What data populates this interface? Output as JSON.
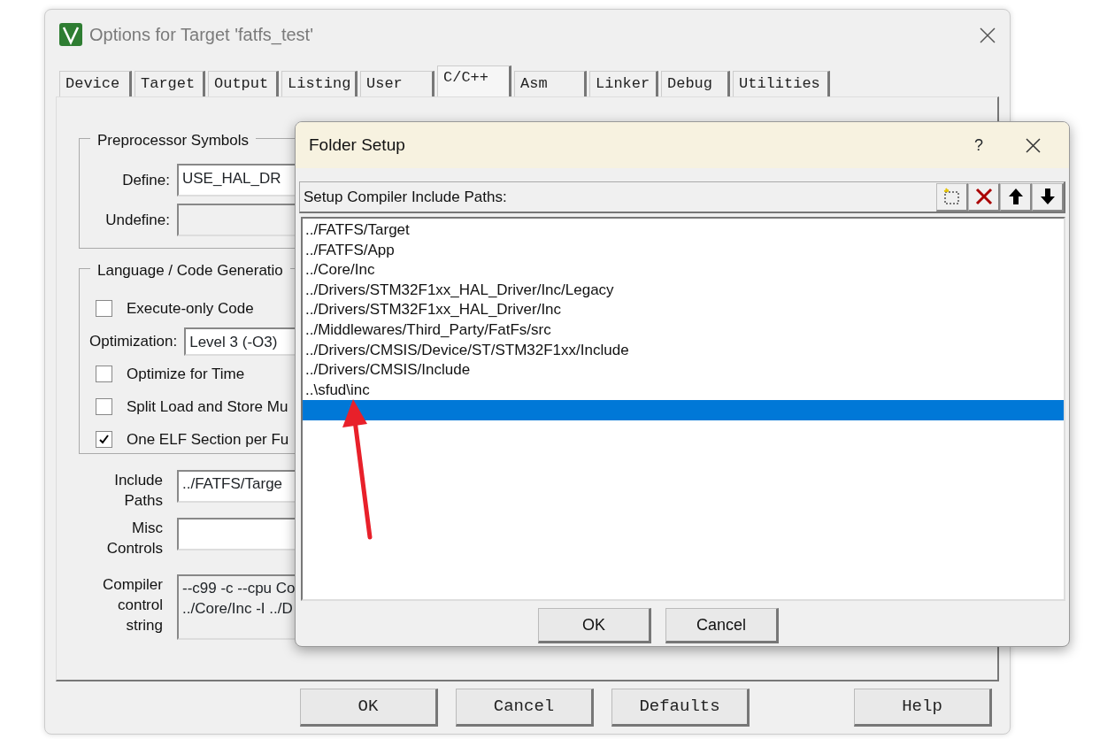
{
  "window": {
    "title": "Options for Target 'fatfs_test'"
  },
  "tabs": [
    {
      "label": "Device",
      "selected": false
    },
    {
      "label": "Target",
      "selected": false
    },
    {
      "label": "Output",
      "selected": false
    },
    {
      "label": "Listing",
      "selected": false
    },
    {
      "label": "User",
      "selected": false
    },
    {
      "label": "C/C++",
      "selected": true
    },
    {
      "label": "Asm",
      "selected": false
    },
    {
      "label": "Linker",
      "selected": false
    },
    {
      "label": "Debug",
      "selected": false
    },
    {
      "label": "Utilities",
      "selected": false
    }
  ],
  "preprocessor": {
    "title": "Preprocessor Symbols",
    "fields": [
      {
        "label": "Define:",
        "value": "USE_HAL_DR"
      },
      {
        "label": "Undefine:"
      }
    ]
  },
  "language": {
    "title": "Language / Code Generatio",
    "items": [
      {
        "kind": "checkbox",
        "label": "Execute-only Code",
        "checked": false
      },
      {
        "kind": "select",
        "label": "Optimization:",
        "value": "Level 3 (-O3)"
      },
      {
        "kind": "checkbox",
        "label": "Optimize for Time",
        "checked": false
      },
      {
        "kind": "checkbox",
        "label": "Split Load and Store Mu",
        "checked": false
      },
      {
        "kind": "checkbox",
        "label": "One ELF Section per Fu",
        "checked": true
      }
    ]
  },
  "controls": [
    {
      "label": "Include Paths",
      "lines": [
        "../FATFS/Targe"
      ]
    },
    {
      "label": "Misc Controls"
    },
    {
      "label": "Compiler control string",
      "lines": [
        "--c99 -c --cpu Co",
        "../Core/Inc -I ../D"
      ]
    }
  ],
  "buttons": [
    "OK",
    "Cancel",
    "Defaults",
    "Help"
  ],
  "dialog": {
    "title": "Folder Setup",
    "help": "?",
    "header": "Setup Compiler Include Paths:",
    "paths": [
      {
        "text": "../FATFS/Target",
        "selected": false
      },
      {
        "text": "../FATFS/App",
        "selected": false
      },
      {
        "text": "../Core/Inc",
        "selected": false
      },
      {
        "text": "../Drivers/STM32F1xx_HAL_Driver/Inc/Legacy",
        "selected": false
      },
      {
        "text": "../Drivers/STM32F1xx_HAL_Driver/Inc",
        "selected": false
      },
      {
        "text": "../Middlewares/Third_Party/FatFs/src",
        "selected": false
      },
      {
        "text": "../Drivers/CMSIS/Device/ST/STM32F1xx/Include",
        "selected": false
      },
      {
        "text": "../Drivers/CMSIS/Include",
        "selected": false
      },
      {
        "text": "..\\sfud\\inc",
        "selected": false
      }
    ],
    "new_row": {
      "selected": true
    },
    "buttons": [
      "OK",
      "Cancel"
    ]
  }
}
